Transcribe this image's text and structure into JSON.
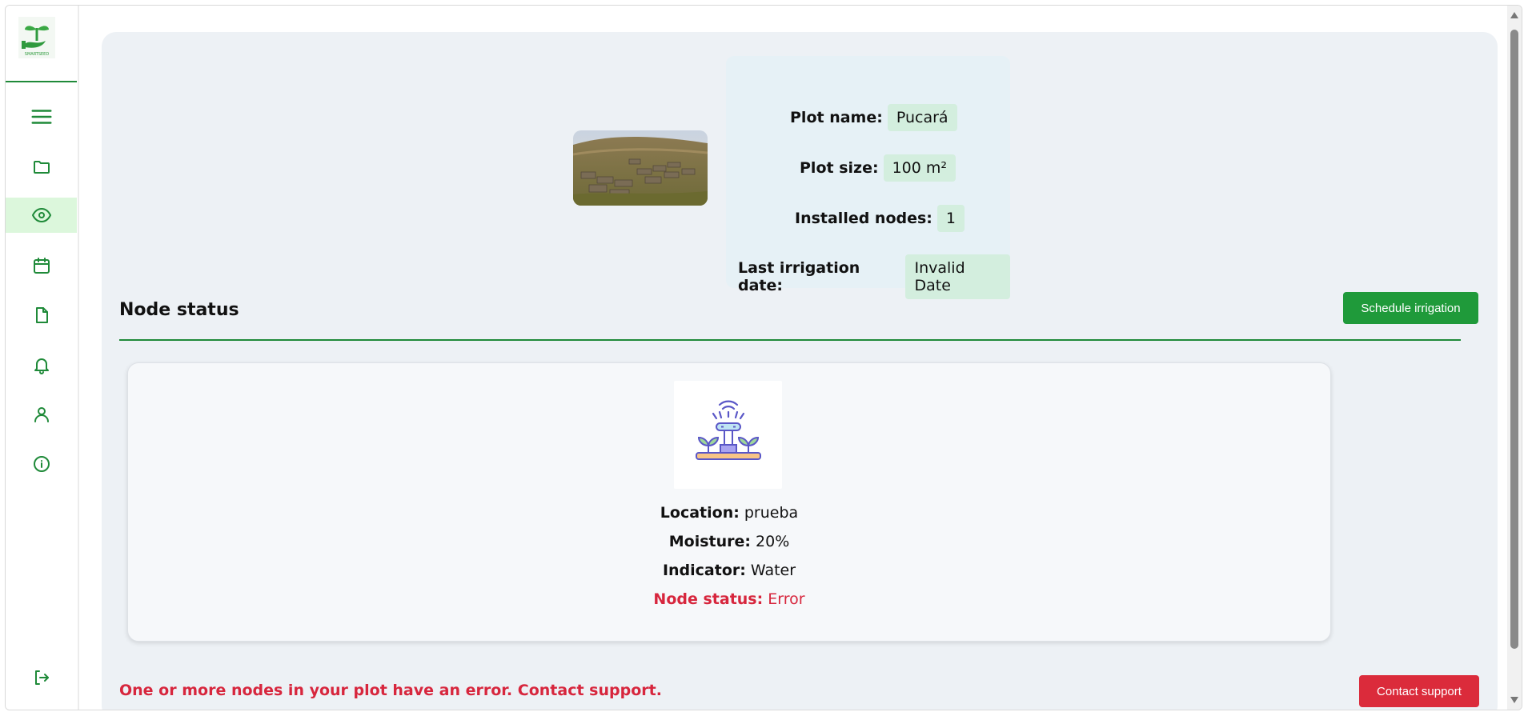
{
  "app": {
    "logo_text": "SMARTSEED"
  },
  "sidebar": {
    "items": [
      {
        "icon": "menu-icon"
      },
      {
        "icon": "folder-icon"
      },
      {
        "icon": "eye-icon",
        "active": true
      },
      {
        "icon": "calendar-icon"
      },
      {
        "icon": "document-icon"
      },
      {
        "icon": "bell-icon"
      },
      {
        "icon": "user-icon"
      },
      {
        "icon": "info-icon"
      },
      {
        "icon": "logout-icon"
      }
    ]
  },
  "plot": {
    "name_label": "Plot name:",
    "name_value": "Pucará",
    "size_label": "Plot size:",
    "size_value": "100 m²",
    "nodes_label": "Installed nodes:",
    "nodes_value": "1",
    "last_irrigation_label": "Last irrigation date:",
    "last_irrigation_value": "Invalid Date"
  },
  "node_section": {
    "title": "Node status",
    "schedule_button": "Schedule irrigation"
  },
  "node": {
    "location_label": "Location:",
    "location_value": "prueba",
    "moisture_label": "Moisture:",
    "moisture_value": "20%",
    "indicator_label": "Indicator:",
    "indicator_value": "Water",
    "status_label": "Node status:",
    "status_value": "Error"
  },
  "footer": {
    "error_message": "One or more nodes in your plot have an error. Contact support.",
    "contact_button": "Contact support"
  },
  "colors": {
    "brand_green": "#1f8a39",
    "button_green": "#1f9a3a",
    "error_red": "#d7263d",
    "panel_bg": "#edf1f5"
  }
}
